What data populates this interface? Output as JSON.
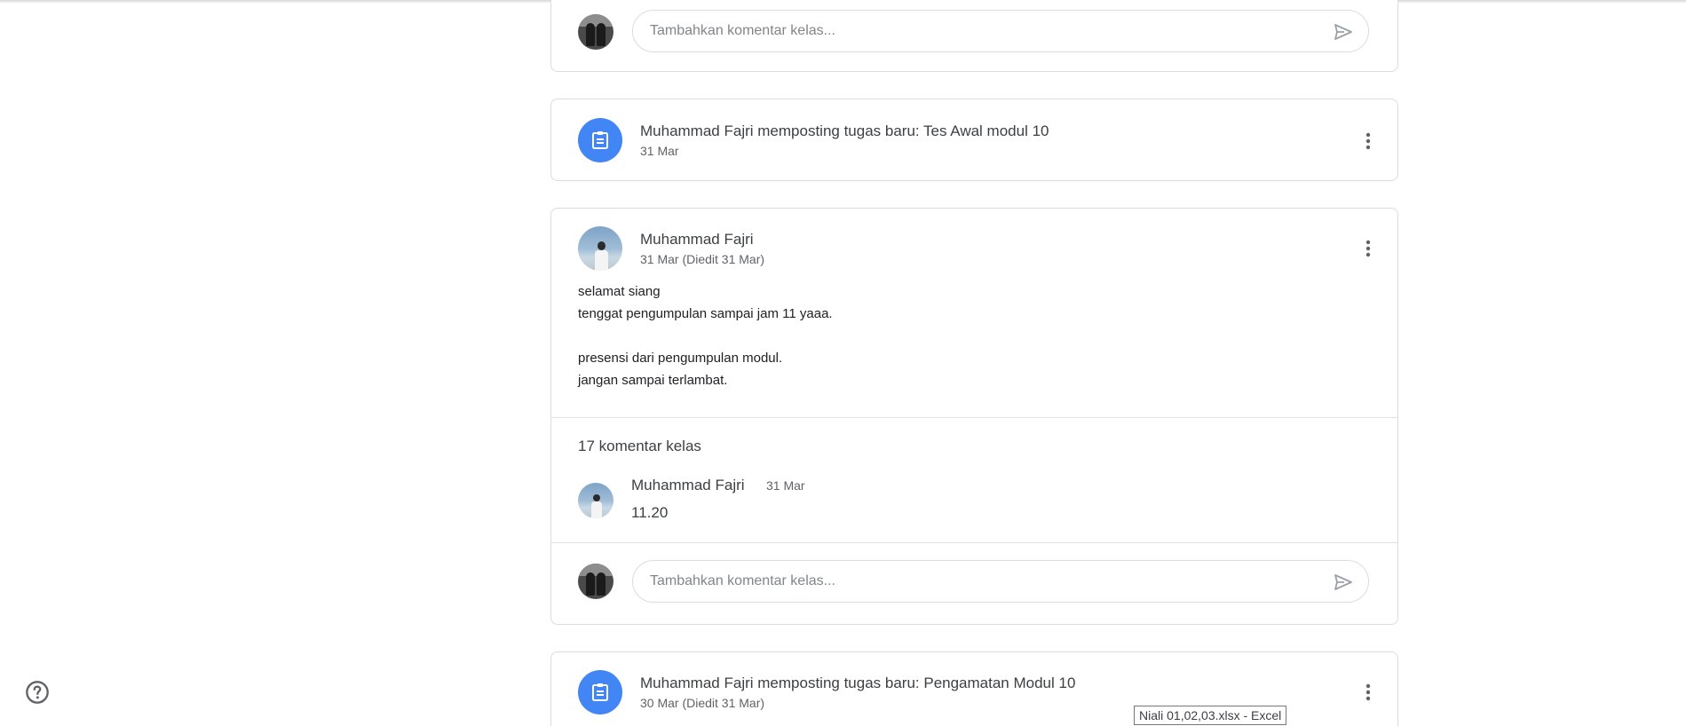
{
  "comment_box": {
    "placeholder": "Tambahkan komentar kelas..."
  },
  "posts": [
    {
      "type": "assignment",
      "title": "Muhammad Fajri memposting tugas baru: Tes Awal modul 10",
      "date": "31 Mar"
    },
    {
      "type": "announcement",
      "author": "Muhammad Fajri",
      "date": "31 Mar (Diedit 31 Mar)",
      "body": "selamat siang\ntenggat pengumpulan sampai jam 11 yaaa.\n\npresensi dari pengumpulan modul.\njangan sampai terlambat.",
      "comments_count_label": "17 komentar kelas",
      "comments": [
        {
          "author": "Muhammad Fajri",
          "date": "31 Mar",
          "text": "11.20"
        }
      ]
    },
    {
      "type": "assignment",
      "title": "Muhammad Fajri memposting tugas baru: Pengamatan Modul 10",
      "date": "30 Mar (Diedit 31 Mar)"
    }
  ],
  "tooltip": "Niali 01,02,03.xlsx - Excel",
  "icons": {
    "send": "send-icon",
    "assignment": "assignment-icon",
    "more": "more-vert-icon",
    "help": "help-icon"
  },
  "colors": {
    "accent": "#4285f4",
    "border": "#dadce0"
  }
}
